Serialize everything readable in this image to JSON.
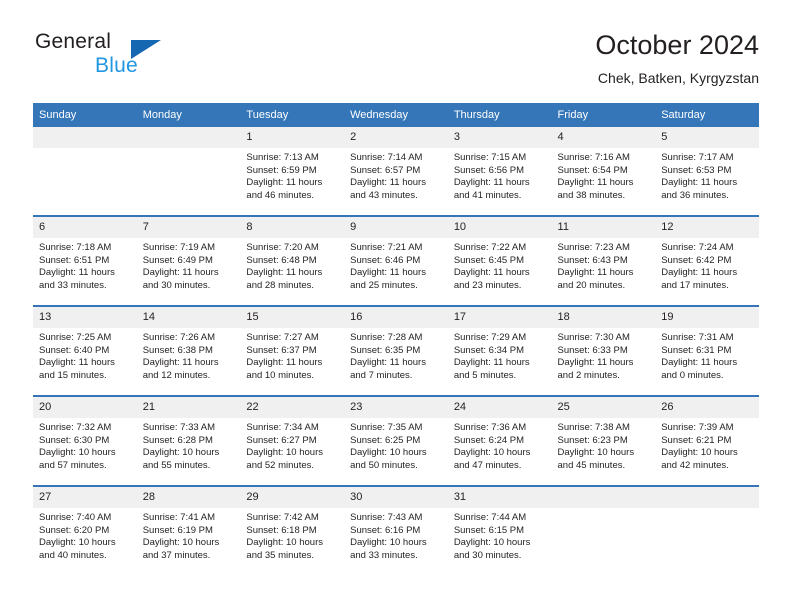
{
  "brand": {
    "name_top": "General",
    "name_bottom": "Blue",
    "accent_dark": "#1567b2",
    "accent_light": "#2196e3"
  },
  "header": {
    "title": "October 2024",
    "subtitle": "Chek, Batken, Kyrgyzstan"
  },
  "theme": {
    "header_blue": "#3476b8",
    "daynum_bg": "#f0f0f0",
    "text": "#231f20"
  },
  "weekday_headers": [
    "Sunday",
    "Monday",
    "Tuesday",
    "Wednesday",
    "Thursday",
    "Friday",
    "Saturday"
  ],
  "weeks": [
    [
      {
        "day": "",
        "sunrise": "",
        "sunset": "",
        "daylight": "",
        "empty": true
      },
      {
        "day": "",
        "sunrise": "",
        "sunset": "",
        "daylight": "",
        "empty": true
      },
      {
        "day": "1",
        "sunrise": "Sunrise: 7:13 AM",
        "sunset": "Sunset: 6:59 PM",
        "daylight": "Daylight: 11 hours and 46 minutes."
      },
      {
        "day": "2",
        "sunrise": "Sunrise: 7:14 AM",
        "sunset": "Sunset: 6:57 PM",
        "daylight": "Daylight: 11 hours and 43 minutes."
      },
      {
        "day": "3",
        "sunrise": "Sunrise: 7:15 AM",
        "sunset": "Sunset: 6:56 PM",
        "daylight": "Daylight: 11 hours and 41 minutes."
      },
      {
        "day": "4",
        "sunrise": "Sunrise: 7:16 AM",
        "sunset": "Sunset: 6:54 PM",
        "daylight": "Daylight: 11 hours and 38 minutes."
      },
      {
        "day": "5",
        "sunrise": "Sunrise: 7:17 AM",
        "sunset": "Sunset: 6:53 PM",
        "daylight": "Daylight: 11 hours and 36 minutes."
      }
    ],
    [
      {
        "day": "6",
        "sunrise": "Sunrise: 7:18 AM",
        "sunset": "Sunset: 6:51 PM",
        "daylight": "Daylight: 11 hours and 33 minutes."
      },
      {
        "day": "7",
        "sunrise": "Sunrise: 7:19 AM",
        "sunset": "Sunset: 6:49 PM",
        "daylight": "Daylight: 11 hours and 30 minutes."
      },
      {
        "day": "8",
        "sunrise": "Sunrise: 7:20 AM",
        "sunset": "Sunset: 6:48 PM",
        "daylight": "Daylight: 11 hours and 28 minutes."
      },
      {
        "day": "9",
        "sunrise": "Sunrise: 7:21 AM",
        "sunset": "Sunset: 6:46 PM",
        "daylight": "Daylight: 11 hours and 25 minutes."
      },
      {
        "day": "10",
        "sunrise": "Sunrise: 7:22 AM",
        "sunset": "Sunset: 6:45 PM",
        "daylight": "Daylight: 11 hours and 23 minutes."
      },
      {
        "day": "11",
        "sunrise": "Sunrise: 7:23 AM",
        "sunset": "Sunset: 6:43 PM",
        "daylight": "Daylight: 11 hours and 20 minutes."
      },
      {
        "day": "12",
        "sunrise": "Sunrise: 7:24 AM",
        "sunset": "Sunset: 6:42 PM",
        "daylight": "Daylight: 11 hours and 17 minutes."
      }
    ],
    [
      {
        "day": "13",
        "sunrise": "Sunrise: 7:25 AM",
        "sunset": "Sunset: 6:40 PM",
        "daylight": "Daylight: 11 hours and 15 minutes."
      },
      {
        "day": "14",
        "sunrise": "Sunrise: 7:26 AM",
        "sunset": "Sunset: 6:38 PM",
        "daylight": "Daylight: 11 hours and 12 minutes."
      },
      {
        "day": "15",
        "sunrise": "Sunrise: 7:27 AM",
        "sunset": "Sunset: 6:37 PM",
        "daylight": "Daylight: 11 hours and 10 minutes."
      },
      {
        "day": "16",
        "sunrise": "Sunrise: 7:28 AM",
        "sunset": "Sunset: 6:35 PM",
        "daylight": "Daylight: 11 hours and 7 minutes."
      },
      {
        "day": "17",
        "sunrise": "Sunrise: 7:29 AM",
        "sunset": "Sunset: 6:34 PM",
        "daylight": "Daylight: 11 hours and 5 minutes."
      },
      {
        "day": "18",
        "sunrise": "Sunrise: 7:30 AM",
        "sunset": "Sunset: 6:33 PM",
        "daylight": "Daylight: 11 hours and 2 minutes."
      },
      {
        "day": "19",
        "sunrise": "Sunrise: 7:31 AM",
        "sunset": "Sunset: 6:31 PM",
        "daylight": "Daylight: 11 hours and 0 minutes."
      }
    ],
    [
      {
        "day": "20",
        "sunrise": "Sunrise: 7:32 AM",
        "sunset": "Sunset: 6:30 PM",
        "daylight": "Daylight: 10 hours and 57 minutes."
      },
      {
        "day": "21",
        "sunrise": "Sunrise: 7:33 AM",
        "sunset": "Sunset: 6:28 PM",
        "daylight": "Daylight: 10 hours and 55 minutes."
      },
      {
        "day": "22",
        "sunrise": "Sunrise: 7:34 AM",
        "sunset": "Sunset: 6:27 PM",
        "daylight": "Daylight: 10 hours and 52 minutes."
      },
      {
        "day": "23",
        "sunrise": "Sunrise: 7:35 AM",
        "sunset": "Sunset: 6:25 PM",
        "daylight": "Daylight: 10 hours and 50 minutes."
      },
      {
        "day": "24",
        "sunrise": "Sunrise: 7:36 AM",
        "sunset": "Sunset: 6:24 PM",
        "daylight": "Daylight: 10 hours and 47 minutes."
      },
      {
        "day": "25",
        "sunrise": "Sunrise: 7:38 AM",
        "sunset": "Sunset: 6:23 PM",
        "daylight": "Daylight: 10 hours and 45 minutes."
      },
      {
        "day": "26",
        "sunrise": "Sunrise: 7:39 AM",
        "sunset": "Sunset: 6:21 PM",
        "daylight": "Daylight: 10 hours and 42 minutes."
      }
    ],
    [
      {
        "day": "27",
        "sunrise": "Sunrise: 7:40 AM",
        "sunset": "Sunset: 6:20 PM",
        "daylight": "Daylight: 10 hours and 40 minutes."
      },
      {
        "day": "28",
        "sunrise": "Sunrise: 7:41 AM",
        "sunset": "Sunset: 6:19 PM",
        "daylight": "Daylight: 10 hours and 37 minutes."
      },
      {
        "day": "29",
        "sunrise": "Sunrise: 7:42 AM",
        "sunset": "Sunset: 6:18 PM",
        "daylight": "Daylight: 10 hours and 35 minutes."
      },
      {
        "day": "30",
        "sunrise": "Sunrise: 7:43 AM",
        "sunset": "Sunset: 6:16 PM",
        "daylight": "Daylight: 10 hours and 33 minutes."
      },
      {
        "day": "31",
        "sunrise": "Sunrise: 7:44 AM",
        "sunset": "Sunset: 6:15 PM",
        "daylight": "Daylight: 10 hours and 30 minutes."
      },
      {
        "day": "",
        "sunrise": "",
        "sunset": "",
        "daylight": "",
        "empty": true
      },
      {
        "day": "",
        "sunrise": "",
        "sunset": "",
        "daylight": "",
        "empty": true
      }
    ]
  ]
}
